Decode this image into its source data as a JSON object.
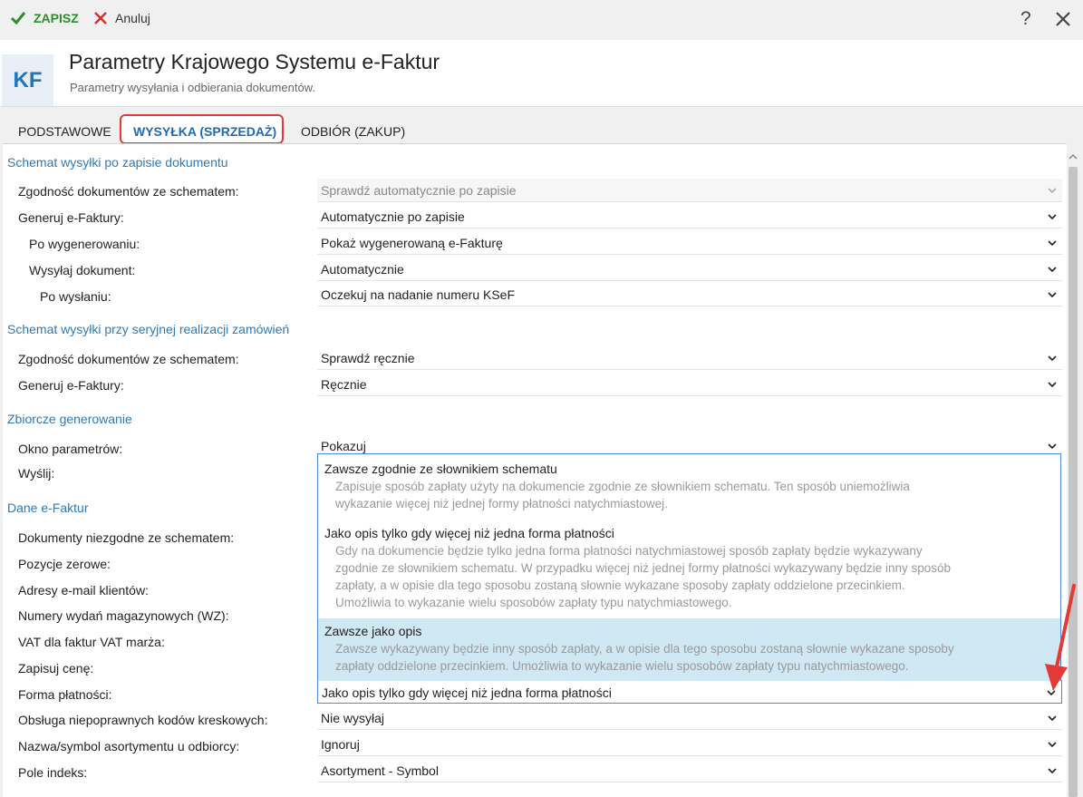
{
  "toolbar": {
    "save_label": "ZAPISZ",
    "cancel_label": "Anuluj",
    "help_label": "?"
  },
  "header": {
    "logo": "KF",
    "title": "Parametry Krajowego Systemu e-Faktur",
    "subtitle": "Parametry wysyłania i odbierania dokumentów."
  },
  "tabs": [
    {
      "label": "PODSTAWOWE"
    },
    {
      "label": "WYSYŁKA (SPRZEDAŻ)"
    },
    {
      "label": "ODBIÓR (ZAKUP)"
    }
  ],
  "sections": {
    "s1": "Schemat wysyłki po zapisie dokumentu",
    "s2": "Schemat wysyłki przy seryjnej realizacji zamówień",
    "s3": "Zbiorcze generowanie",
    "s4": "Dane e-Faktur"
  },
  "rows": {
    "zgodnosc1": {
      "label": "Zgodność dokumentów ze schematem:",
      "value": "Sprawdź automatycznie po zapisie"
    },
    "generuj1": {
      "label": "Generuj e-Faktury:",
      "value": "Automatycznie po zapisie"
    },
    "po_wygen": {
      "label": "Po wygenerowaniu:",
      "value": "Pokaż wygenerowaną e-Fakturę"
    },
    "wysylaj": {
      "label": "Wysyłaj dokument:",
      "value": "Automatycznie"
    },
    "po_wyslaniu": {
      "label": "Po wysłaniu:",
      "value": "Oczekuj na nadanie numeru KSeF"
    },
    "zgodnosc2": {
      "label": "Zgodność dokumentów ze schematem:",
      "value": "Sprawdź ręcznie"
    },
    "generuj2": {
      "label": "Generuj e-Faktury:",
      "value": "Ręcznie"
    },
    "okno": {
      "label": "Okno parametrów:",
      "value": "Pokazuj"
    },
    "wyslij": {
      "label": "Wyślij:"
    },
    "dok_niezg": {
      "label": "Dokumenty niezgodne ze schematem:"
    },
    "poz_zerowe": {
      "label": "Pozycje zerowe:"
    },
    "adresy": {
      "label": "Adresy e-mail klientów:"
    },
    "numery_wz": {
      "label": "Numery wydań magazynowych (WZ):"
    },
    "vat_marza": {
      "label": "VAT dla faktur VAT marża:"
    },
    "zapisuj_cene": {
      "label": "Zapisuj cenę:"
    },
    "forma": {
      "label": "Forma płatności:",
      "value": "Jako opis tylko gdy więcej niż jedna forma płatności"
    },
    "obsluga": {
      "label": "Obsługa niepoprawnych kodów kreskowych:",
      "value": "Nie wysyłaj"
    },
    "nazwa": {
      "label": "Nazwa/symbol asortymentu u odbiorcy:",
      "value": "Ignoruj"
    },
    "pole": {
      "label": "Pole indeks:",
      "value": "Asortyment - Symbol"
    }
  },
  "dropdown": {
    "options": [
      {
        "title": "Zawsze zgodnie ze słownikiem schematu",
        "desc1": "Zapisuje sposób zapłaty użyty na dokumencie zgodnie ze słownikiem schematu. Ten sposób uniemożliwia",
        "desc2": "wykazanie więcej niż jednej formy płatności natychmiastowej."
      },
      {
        "title": "Jako opis tylko gdy więcej niż jedna forma płatności",
        "desc1": "Gdy na dokumencie będzie tylko jedna forma płatności natychmiastowej sposób zapłaty będzie wykazywany",
        "desc2": "zgodnie ze słownikiem schematu. W przypadku więcej niż jednej formy płatności wykazywany będzie inny sposób",
        "desc3": "zapłaty, a w opisie dla tego sposobu zostaną słownie wykazane sposoby zapłaty oddzielone przecinkiem.",
        "desc4": "Umożliwia to wykazanie wielu sposobów zapłaty typu natychmiastowego."
      },
      {
        "title": "Zawsze jako opis",
        "desc1": "Zawsze wykazywany będzie inny sposób zapłaty, a w opisie dla tego sposobu zostaną słownie wykazane sposoby",
        "desc2": "zapłaty oddzielone przecinkiem. Umożliwia to wykazanie wielu sposobów zapłaty typu natychmiastowego."
      }
    ]
  },
  "colors": {
    "accent": "#2c7ab8",
    "save_green": "#2e8b2e",
    "cancel_red": "#d32f2f",
    "highlight": "#e53935",
    "selected_bg": "#cfe8f3"
  }
}
